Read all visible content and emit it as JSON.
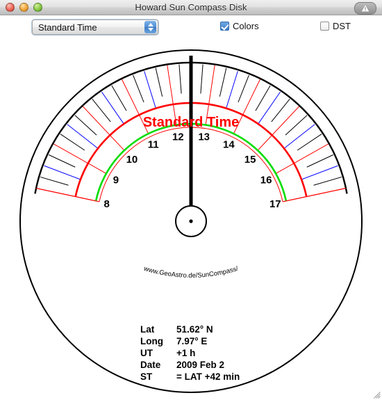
{
  "window": {
    "title": "Howard Sun Compass Disk",
    "controls": {
      "close": "close",
      "minimize": "minimize",
      "zoom": "zoom",
      "warning": "warning-badge"
    },
    "resize_grip": "resize-grip"
  },
  "toolbar": {
    "mode_select": {
      "value": "Standard Time",
      "options": [
        "Standard Time"
      ]
    },
    "colors_checkbox": {
      "label": "Colors",
      "checked": true
    },
    "dst_checkbox": {
      "label": "DST",
      "checked": false
    }
  },
  "dial": {
    "caption": "Standard Time",
    "caption_color": "#ff0000",
    "credit": "www.GeoAstro.de/SunCompass/",
    "hour_labels": [
      "8",
      "9",
      "10",
      "11",
      "12",
      "13",
      "14",
      "15",
      "16",
      "17"
    ],
    "colors": {
      "outer_arc": "#000000",
      "mid_arc": "#ff0000",
      "inner_arc": "#00dd00",
      "hour_line": "#ff0000",
      "half_line": "#0000ff",
      "quarter_line": "#000000",
      "needle": "#000000",
      "rim": "#000000"
    }
  },
  "info": {
    "rows": [
      {
        "label": "Lat",
        "value": "51.62° N"
      },
      {
        "label": "Long",
        "value": "7.97° E"
      },
      {
        "label": "UT",
        "value": "+1 h"
      },
      {
        "label": "Date",
        "value": "2009 Feb 2"
      },
      {
        "label": "ST",
        "value": "= LAT +42 min"
      }
    ]
  }
}
